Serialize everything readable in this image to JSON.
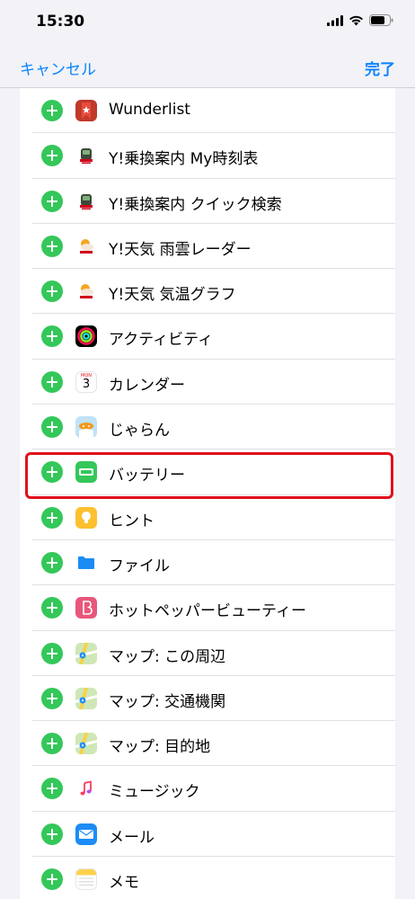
{
  "status_bar": {
    "time": "15:30"
  },
  "nav": {
    "cancel_label": "キャンセル",
    "done_label": "完了"
  },
  "colors": {
    "accent": "#0a84ff",
    "add_green": "#34c759",
    "highlight_red": "#e0101a"
  },
  "list": {
    "items": [
      {
        "label": "Wunderlist",
        "icon": "wunderlist-icon"
      },
      {
        "label": "Y!乗換案内 My時刻表",
        "icon": "yahoo-transit-icon"
      },
      {
        "label": "Y!乗換案内 クイック検索",
        "icon": "yahoo-transit-icon"
      },
      {
        "label": "Y!天気 雨雲レーダー",
        "icon": "yahoo-weather-icon"
      },
      {
        "label": "Y!天気 気温グラフ",
        "icon": "yahoo-weather-icon"
      },
      {
        "label": "アクティビティ",
        "icon": "activity-icon"
      },
      {
        "label": "カレンダー",
        "icon": "calendar-icon"
      },
      {
        "label": "じゃらん",
        "icon": "jalan-icon"
      },
      {
        "label": "バッテリー",
        "icon": "battery-icon",
        "highlighted": true
      },
      {
        "label": "ヒント",
        "icon": "tips-icon"
      },
      {
        "label": "ファイル",
        "icon": "files-icon"
      },
      {
        "label": "ホットペッパービューティー",
        "icon": "hotpepper-beauty-icon"
      },
      {
        "label": "マップ: この周辺",
        "icon": "maps-icon"
      },
      {
        "label": "マップ: 交通機関",
        "icon": "maps-icon"
      },
      {
        "label": "マップ: 目的地",
        "icon": "maps-icon"
      },
      {
        "label": "ミュージック",
        "icon": "music-icon"
      },
      {
        "label": "メール",
        "icon": "mail-icon"
      },
      {
        "label": "メモ",
        "icon": "notes-icon"
      }
    ],
    "calendar_day": "3",
    "calendar_weekday": "MON"
  }
}
